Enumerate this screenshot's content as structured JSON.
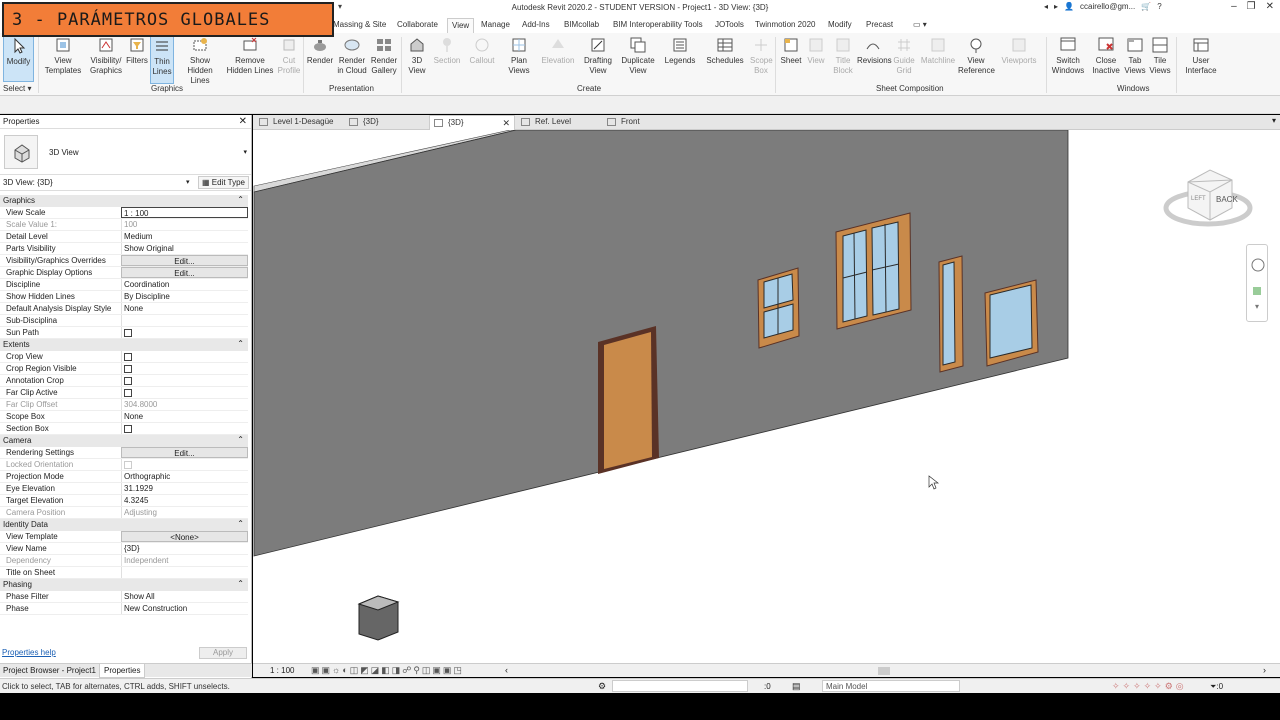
{
  "banner": {
    "text": "3 - PARÁMETROS GLOBALES"
  },
  "titlebar": {
    "title": "Autodesk Revit 2020.2 - STUDENT VERSION - Project1 - 3D View: {3D}",
    "account": "ccairello@gm..."
  },
  "ribbon_tabs": [
    "Massing & Site",
    "Collaborate",
    "View",
    "Manage",
    "Add-Ins",
    "BIMcollab",
    "BIM Interoperability Tools",
    "JOTools",
    "Twinmotion 2020",
    "Modify",
    "Precast"
  ],
  "ribbon": {
    "modify": "Modify",
    "select": "Select",
    "graphics": [
      "View Templates",
      "Visibility/ Graphics",
      "Filters",
      "Thin Lines",
      "Show Hidden Lines",
      "Remove Hidden Lines",
      "Cut Profile"
    ],
    "presentation": [
      "Render",
      "Render in Cloud",
      "Render Gallery"
    ],
    "create": [
      "3D View",
      "Section",
      "Callout",
      "Plan Views",
      "Elevation",
      "Drafting View",
      "Duplicate View",
      "Legends",
      "Schedules",
      "Scope Box"
    ],
    "sheet": [
      "Sheet",
      "View",
      "Title Block",
      "Revisions",
      "Guide Grid",
      "Matchline",
      "View Reference",
      "Viewports"
    ],
    "windows": [
      "Switch Windows",
      "Close Inactive",
      "Tab Views",
      "Tile Views",
      "User Interface"
    ],
    "panels": {
      "graphics": "Graphics",
      "presentation": "Presentation",
      "create": "Create",
      "sheet": "Sheet Composition",
      "windows": "Windows"
    }
  },
  "properties": {
    "title": "Properties",
    "type_name": "3D View",
    "selector": "3D View: {3D}",
    "edit_type": "Edit Type",
    "groups": {
      "graphics": "Graphics",
      "extents": "Extents",
      "camera": "Camera",
      "identity": "Identity Data",
      "phasing": "Phasing"
    },
    "rows": {
      "view_scale": [
        "View Scale",
        "1 : 100"
      ],
      "scale_value": [
        "Scale Value    1:",
        "100"
      ],
      "detail_level": [
        "Detail Level",
        "Medium"
      ],
      "parts_visibility": [
        "Parts Visibility",
        "Show Original"
      ],
      "vg_overrides": [
        "Visibility/Graphics Overrides",
        "Edit..."
      ],
      "gdo": [
        "Graphic Display Options",
        "Edit..."
      ],
      "discipline": [
        "Discipline",
        "Coordination"
      ],
      "hidden_lines": [
        "Show Hidden Lines",
        "By Discipline"
      ],
      "analysis_style": [
        "Default Analysis Display Style",
        "None"
      ],
      "sub_discipline": [
        "Sub-Disciplina",
        ""
      ],
      "sun_path": [
        "Sun Path",
        ""
      ],
      "crop_view": [
        "Crop View",
        ""
      ],
      "crop_region": [
        "Crop Region Visible",
        ""
      ],
      "annotation_crop": [
        "Annotation Crop",
        ""
      ],
      "far_clip": [
        "Far Clip Active",
        ""
      ],
      "far_clip_offset": [
        "Far Clip Offset",
        "304.8000"
      ],
      "scope_box": [
        "Scope Box",
        "None"
      ],
      "section_box": [
        "Section Box",
        ""
      ],
      "rendering": [
        "Rendering Settings",
        "Edit..."
      ],
      "locked_orientation": [
        "Locked Orientation",
        ""
      ],
      "projection": [
        "Projection Mode",
        "Orthographic"
      ],
      "eye_elev": [
        "Eye Elevation",
        "31.1929"
      ],
      "target_elev": [
        "Target Elevation",
        "4.3245"
      ],
      "camera_pos": [
        "Camera Position",
        "Adjusting"
      ],
      "view_template": [
        "View Template",
        "<None>"
      ],
      "view_name": [
        "View Name",
        "{3D}"
      ],
      "dependency": [
        "Dependency",
        "Independent"
      ],
      "title_sheet": [
        "Title on Sheet",
        ""
      ],
      "phase_filter": [
        "Phase Filter",
        "Show All"
      ],
      "phase": [
        "Phase",
        "New Construction"
      ]
    },
    "help": "Properties help",
    "apply": "Apply"
  },
  "bottom_tabs": [
    "Project Browser - Project1",
    "Properties"
  ],
  "view_tabs": [
    "Level 1-Desagüe",
    "{3D}",
    "{3D}",
    "Ref. Level",
    "Front"
  ],
  "view_controls": {
    "scale": "1 : 100"
  },
  "viewcube": {
    "face": "BACK",
    "side": "LEFT"
  },
  "status": {
    "message": "Click to select, TAB for alternates, CTRL adds, SHIFT unselects.",
    "zero": ":0",
    "model": "Main Model",
    "filters": ":0"
  },
  "colors": {
    "wall": "#7c7c7c",
    "door": "#c98a4a",
    "frame": "#5a3226",
    "glass": "#a8cde6",
    "banner": "#f27d38"
  }
}
